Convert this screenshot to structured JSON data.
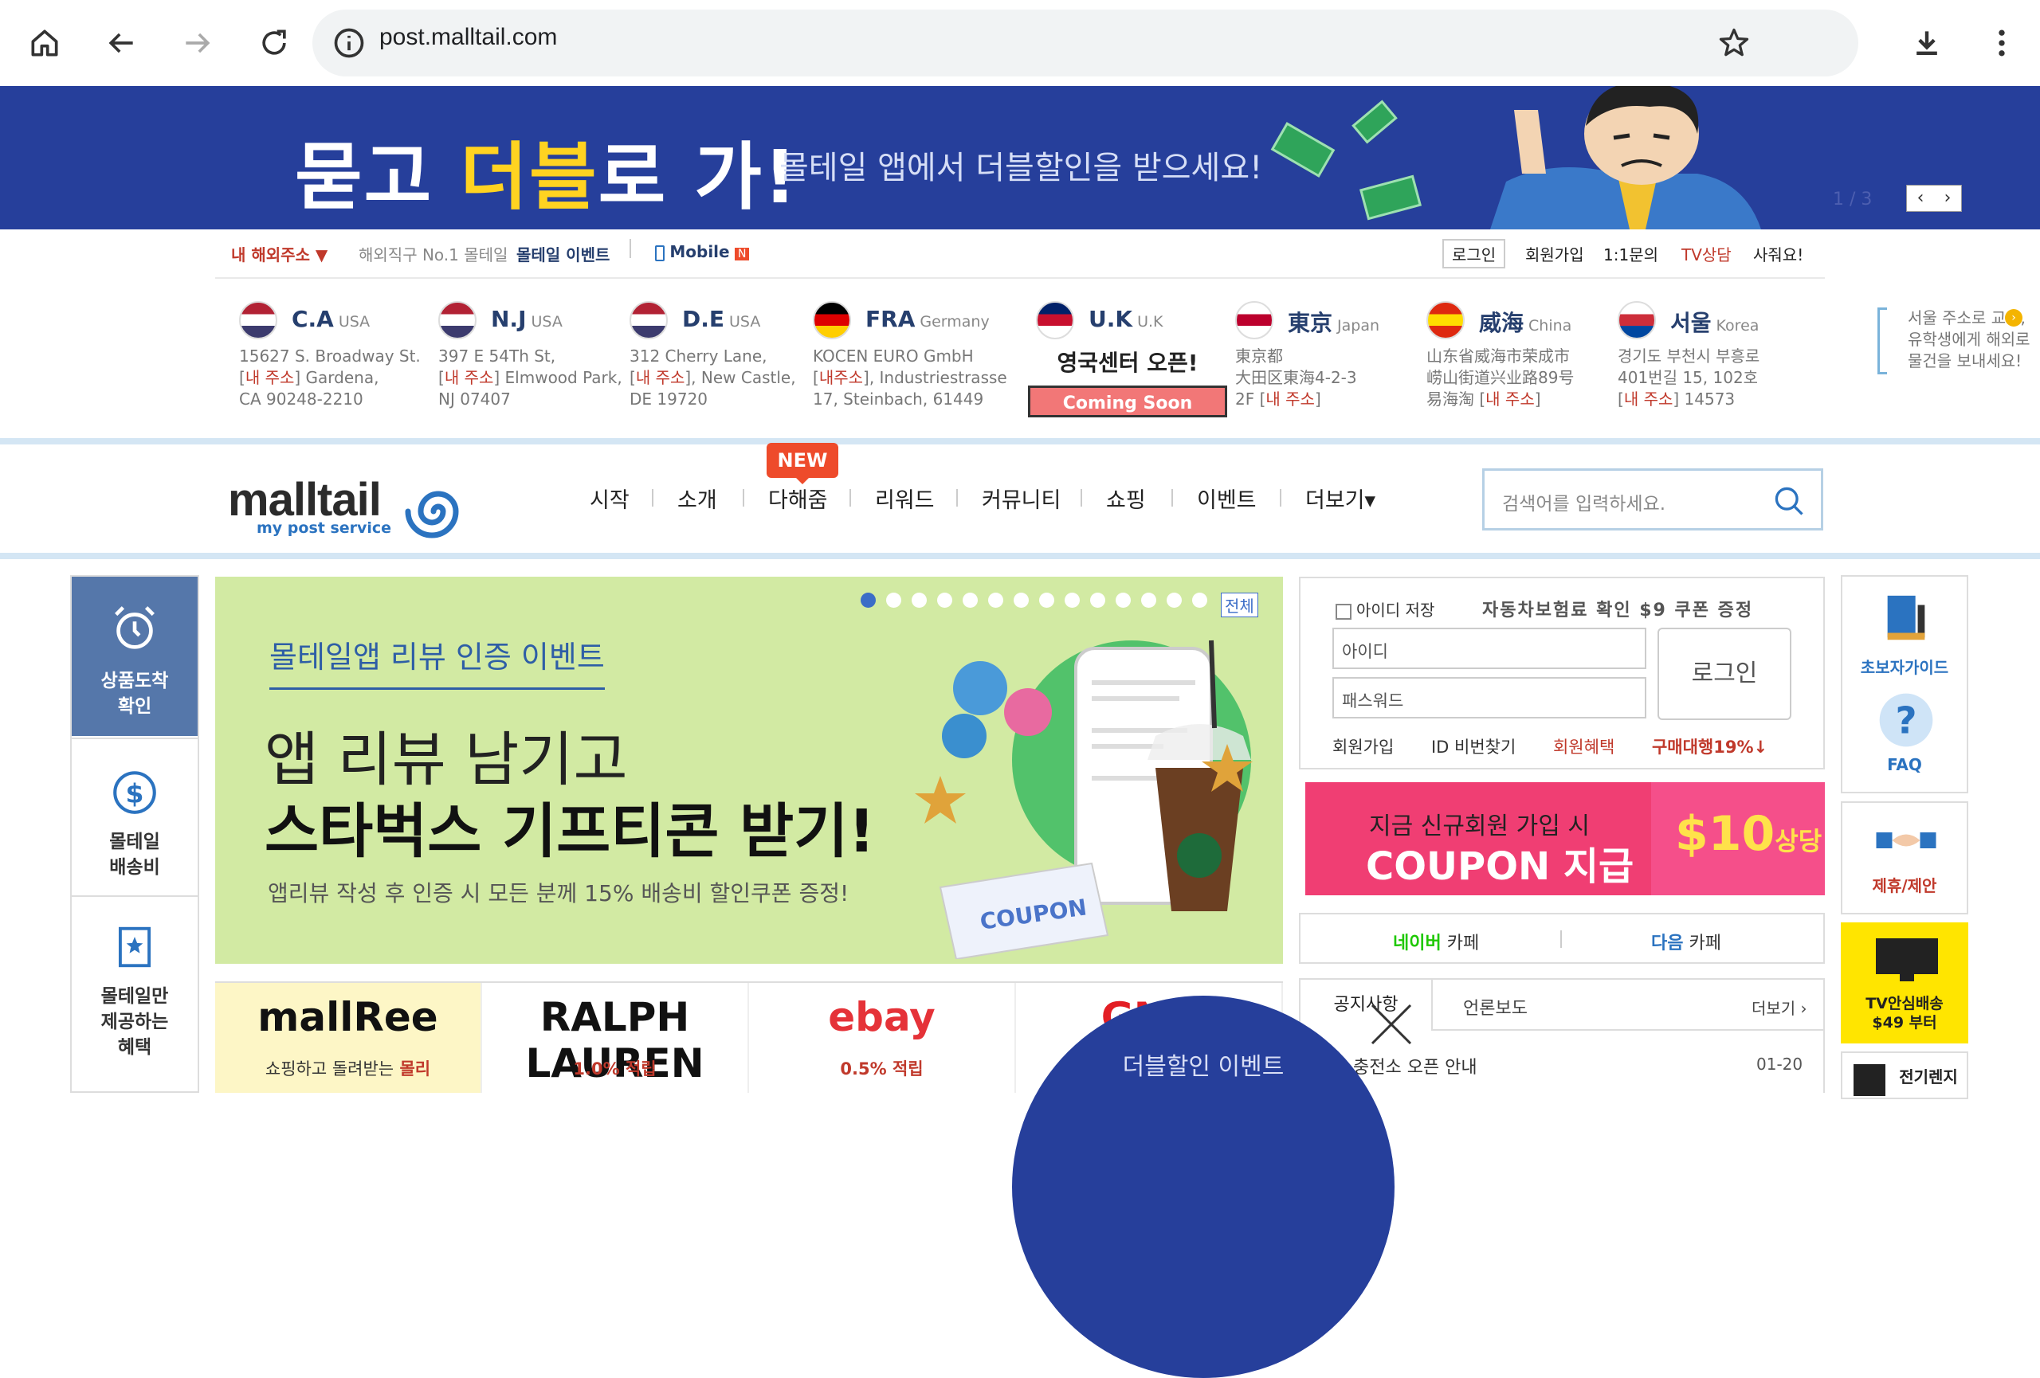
{
  "browser": {
    "url": "post.malltail.com"
  },
  "banner": {
    "headline_part1": "묻고 ",
    "headline_highlight": "더블",
    "headline_part2": "로 가!",
    "subtitle": "몰테일 앱에서 더블할인을 받으세요!",
    "pager": "1 / 3"
  },
  "toplinks": {
    "my_address": "내 해외주소 ▼",
    "slogan": "해외직구 No.1 몰테일",
    "event": "몰테일 이벤트",
    "mobile": "Mobile",
    "mobile_badge": "N",
    "login": "로그인",
    "signup": "회원가입",
    "inquiry": "1:1문의",
    "tv": "TV상담",
    "buy": "사줘요!"
  },
  "warehouses": [
    {
      "code": "C.A",
      "country": "USA",
      "lines": [
        "15627 S. Broadway St.",
        "[|내 주소|] Gardena,",
        "CA 90248-2210"
      ]
    },
    {
      "code": "N.J",
      "country": "USA",
      "lines": [
        "397 E 54Th St,",
        "[|내 주소|] Elmwood Park,",
        "NJ 07407"
      ]
    },
    {
      "code": "D.E",
      "country": "USA",
      "lines": [
        "312 Cherry Lane,",
        "[|내 주소|], New Castle,",
        "DE 19720"
      ]
    },
    {
      "code": "FRA",
      "country": "Germany",
      "lines": [
        "KOCEN EURO GmbH",
        "[|내주소|], Industriestrasse",
        "17, Steinbach, 61449"
      ]
    },
    {
      "code": "U.K",
      "country": "U.K",
      "lines": []
    },
    {
      "code": "東京",
      "country": "Japan",
      "lines": [
        "東京都",
        "大田区東海4-2-3",
        "2F [|내 주소|]"
      ]
    },
    {
      "code": "威海",
      "country": "China",
      "lines": [
        "山东省威海市荣成市",
        "崂山街道兴业路89号",
        "易海淘 [|내 주소|]"
      ]
    },
    {
      "code": "서울",
      "country": "Korea",
      "lines": [
        "경기도 부천시 부흥로",
        "401번길 15, 102호",
        "[|내 주소|] 14573"
      ]
    }
  ],
  "uk_notice": {
    "title": "영국센터 오픈!",
    "ribbon": "Coming Soon"
  },
  "seoul_note": "서울 주소로 교포,유학생에게 해외로 물건을 보내세요!",
  "logo": {
    "word": "malltail",
    "tagline": "my post service"
  },
  "menu": {
    "items": [
      "시작",
      "소개",
      "다해줌",
      "리워드",
      "커뮤니티",
      "쇼핑",
      "이벤트",
      "더보기▾"
    ],
    "new_badge": "NEW",
    "search_placeholder": "검색어를 입력하세요."
  },
  "quick_left": {
    "arrival": "상품도착\n확인",
    "fee": "몰테일\n배송비",
    "exclusive": "몰테일만\n제공하는\n혜택"
  },
  "hero": {
    "kicker": "몰테일앱 리뷰 인증 이벤트",
    "line1": "앱 리뷰 남기고",
    "line2": "스타벅스 기프티콘 받기!",
    "desc": "앱리뷰 작성 후 인증 시 모든 분께 15% 배송비 할인쿠폰 증정!",
    "all": "전체",
    "dot_count": 14,
    "active_dot": 0,
    "coupon_label": "COUPON"
  },
  "brands": [
    {
      "name": "mallRee",
      "sub_prefix": "쇼핑하고 돌려받는",
      "sub": "몰리"
    },
    {
      "name": "RALPH LAUREN",
      "sub_prefix": "",
      "sub": "1.0% 적립"
    },
    {
      "name": "ebay",
      "sub_prefix": "",
      "sub": "0.5% 적립"
    },
    {
      "name": "GNC",
      "sub_prefix": "",
      "sub": ""
    }
  ],
  "login": {
    "save_id": "아이디 저장",
    "promo": "자동차보험료 확인 $9 쿠폰 증정",
    "id_placeholder": "아이디",
    "pw_placeholder": "패스워드",
    "button": "로그인",
    "signup": "회원가입",
    "find": "ID 비번찾기",
    "benefit": "회원혜택",
    "agency": "구매대행19%↓"
  },
  "coupon": {
    "line1": "지금 신규회원 가입 시",
    "line2": "COUPON 지급",
    "amount": "$10",
    "amount_suffix": "상당"
  },
  "cafe": {
    "naver_brand": "네이버",
    "naver_rest": " 카페",
    "daum_brand": "다음",
    "daum_rest": " 카페"
  },
  "notice": {
    "tab1": "공지사항",
    "tab2": "언론보도",
    "more": "더보기 ›",
    "item": "충전소 오픈 안내",
    "date": "01-20"
  },
  "event_popup": {
    "title": "더블할인 이벤트"
  },
  "quick_right": {
    "guide": "초보자가이드",
    "faq": "FAQ",
    "partner": "제휴/제안",
    "tv": "TV안심배송\n$49 부터",
    "range": "전기렌지"
  },
  "colors": {
    "banner_bg": "#263f9b",
    "accent_yellow": "#ffd321",
    "brand_blue": "#2b73c0",
    "red": "#c0392b",
    "hero_bg": "#d2eaa3",
    "coupon_pink": "#f03e73"
  }
}
